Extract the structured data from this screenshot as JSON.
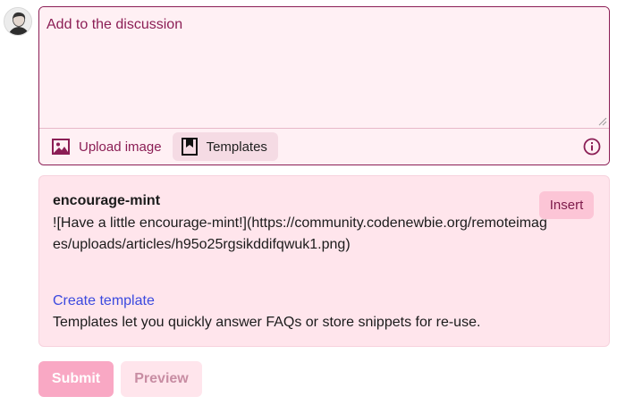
{
  "editor": {
    "placeholder": "Add to the discussion",
    "toolbar": {
      "upload_label": "Upload image",
      "templates_label": "Templates"
    }
  },
  "templates_panel": {
    "title": "encourage-mint",
    "body": "![Have a little encourage-mint!](https://community.codenewbie.org/remoteimages/uploads/articles/h95o25rgsikddifqwuk1.png)",
    "insert_label": "Insert",
    "create_link": "Create template",
    "help_text": "Templates let you quickly answer FAQs or store snippets for re-use."
  },
  "actions": {
    "submit_label": "Submit",
    "preview_label": "Preview"
  },
  "colors": {
    "accent": "#8b1e55",
    "editor_bg": "#fff0f4",
    "panel_bg": "#ffe5ec",
    "link": "#3b49df",
    "submit_bg": "#f9a8c4"
  }
}
